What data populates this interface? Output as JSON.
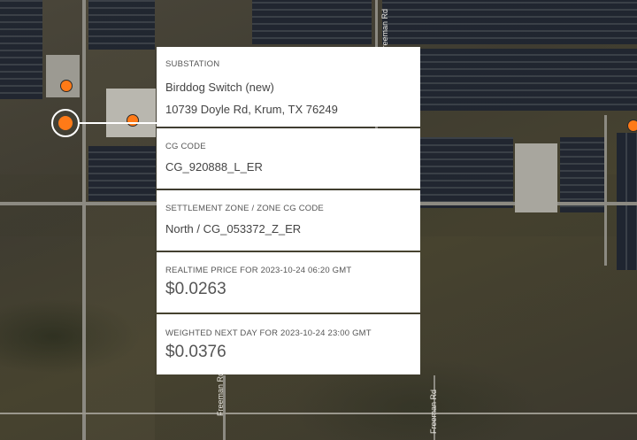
{
  "map": {
    "road_labels": [
      "Freeman Rd",
      "Freeman Rd",
      "Freeman Rd"
    ],
    "marker_color": "#ff7a17"
  },
  "popup": {
    "substation": {
      "label": "SUBSTATION",
      "name": "Birddog Switch (new)",
      "address": "10739 Doyle Rd, Krum, TX 76249"
    },
    "cg_code": {
      "label": "CG CODE",
      "value": "CG_920888_L_ER"
    },
    "settlement_zone": {
      "label": "SETTLEMENT ZONE / ZONE CG CODE",
      "value": "North / CG_053372_Z_ER"
    },
    "realtime_price": {
      "label": "REALTIME PRICE FOR 2023-10-24 06:20 GMT",
      "value": "$0.0263"
    },
    "next_day_price": {
      "label": "WEIGHTED NEXT DAY FOR 2023-10-24 23:00 GMT",
      "value": "$0.0376"
    }
  }
}
